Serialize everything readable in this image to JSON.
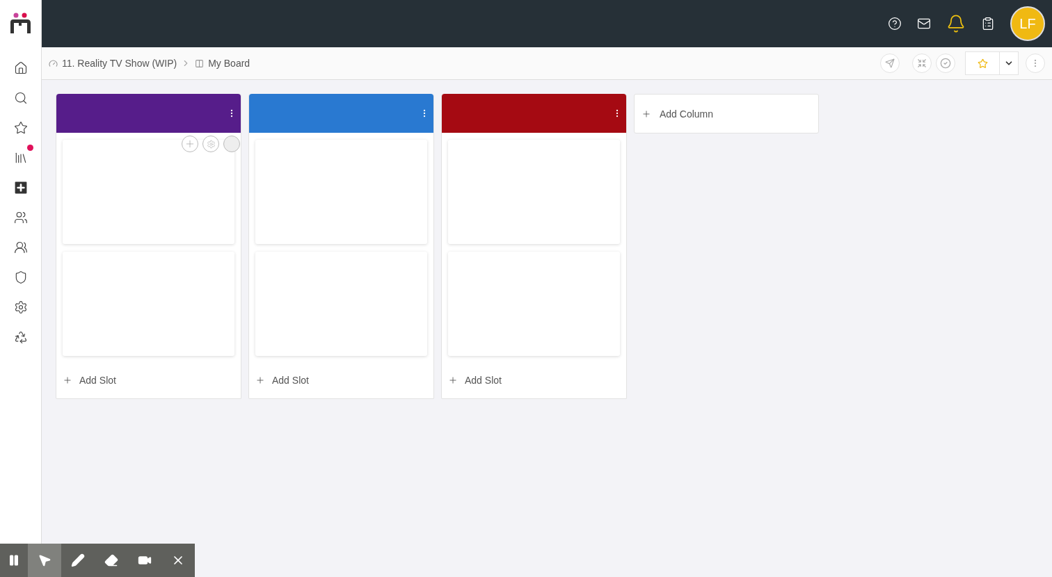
{
  "sidebar": {
    "library_badge": true
  },
  "header": {
    "avatar_initials": "LF",
    "notifications_active": true
  },
  "breadcrumb": [
    {
      "label": "11. Reality TV Show (WIP)",
      "kind": "project"
    },
    {
      "label": "My Board",
      "kind": "board"
    }
  ],
  "columns": [
    {
      "color": "#561d8a",
      "slots": [
        {
          "hovered": true
        },
        {
          "hovered": false
        }
      ],
      "add_slot": "Add Slot"
    },
    {
      "color": "#2979d1",
      "slots": [
        {
          "hovered": false
        },
        {
          "hovered": false
        }
      ],
      "add_slot": "Add Slot"
    },
    {
      "color": "#a50a12",
      "slots": [
        {
          "hovered": false
        },
        {
          "hovered": false
        }
      ],
      "add_slot": "Add Slot"
    }
  ],
  "add_column": "Add Column",
  "recorder": {
    "paused": false,
    "tools": [
      {
        "kind": "pointer",
        "selected": true
      },
      {
        "kind": "pen",
        "selected": false
      },
      {
        "kind": "eraser",
        "selected": false
      },
      {
        "kind": "camera",
        "selected": false
      },
      {
        "kind": "close",
        "selected": false
      }
    ]
  }
}
